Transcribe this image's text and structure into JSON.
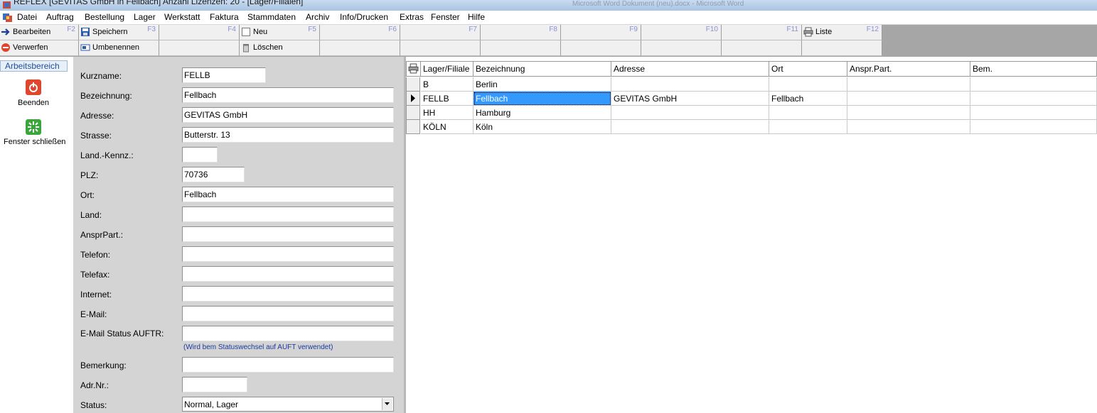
{
  "window": {
    "title": "REFLEX [GEVITAS GmbH in Fellbach] Anzahl Lizenzen: 20 - [Lager/Filialen]",
    "background_title": "Microsoft Word Dokument (neu).docx - Microsoft Word"
  },
  "menu": [
    "Datei",
    "Auftrag",
    "Bestellung",
    "Lager",
    "Werkstatt",
    "Faktura",
    "Stammdaten",
    "Archiv",
    "Info/Drucken",
    "Extras",
    "Fenster",
    "Hilfe"
  ],
  "toolbar": {
    "row1": [
      {
        "label": "Bearbeiten",
        "key": "F2",
        "icon": "arrow-right-icon"
      },
      {
        "label": "Speichern",
        "key": "F3",
        "icon": "save-icon"
      },
      {
        "label": "",
        "key": "F4"
      },
      {
        "label": "Neu",
        "key": "F5",
        "icon": "new-document-icon"
      },
      {
        "label": "",
        "key": "F6"
      },
      {
        "label": "",
        "key": "F7"
      },
      {
        "label": "",
        "key": "F8"
      },
      {
        "label": "",
        "key": "F9"
      },
      {
        "label": "",
        "key": "F10"
      },
      {
        "label": "",
        "key": "F11"
      },
      {
        "label": "Liste",
        "key": "F12",
        "icon": "printer-icon"
      }
    ],
    "row2": [
      {
        "label": "Verwerfen",
        "icon": "cancel-icon"
      },
      {
        "label": "Umbenennen",
        "icon": "rename-icon"
      },
      {
        "label": ""
      },
      {
        "label": "Löschen",
        "icon": "trash-icon"
      },
      {
        "label": ""
      },
      {
        "label": ""
      },
      {
        "label": ""
      },
      {
        "label": ""
      },
      {
        "label": ""
      },
      {
        "label": ""
      }
    ]
  },
  "sidebar": {
    "tab": "Arbeitsbereich",
    "exit_label": "Beenden",
    "close_label": "Fenster schließen"
  },
  "form": {
    "kurzname": {
      "label": "Kurzname:",
      "value": "FELLB"
    },
    "bezeichnung": {
      "label": "Bezeichnung:",
      "value": "Fellbach"
    },
    "adresse": {
      "label": "Adresse:",
      "value": "GEVITAS GmbH"
    },
    "strasse": {
      "label": "Strasse:",
      "value": "Butterstr. 13"
    },
    "land_kennz": {
      "label": "Land.-Kennz.:",
      "value": ""
    },
    "plz": {
      "label": "PLZ:",
      "value": "70736"
    },
    "ort": {
      "label": "Ort:",
      "value": "Fellbach"
    },
    "land": {
      "label": "Land:",
      "value": ""
    },
    "anspr": {
      "label": "AnsprPart.:",
      "value": ""
    },
    "telefon": {
      "label": "Telefon:",
      "value": ""
    },
    "telefax": {
      "label": "Telefax:",
      "value": ""
    },
    "internet": {
      "label": "Internet:",
      "value": ""
    },
    "email": {
      "label": "E-Mail:",
      "value": ""
    },
    "email_status": {
      "label": "E-Mail Status AUFTR:",
      "value": "",
      "hint": "(Wird bem Statuswechsel auf AUFT verwendet)"
    },
    "bemerkung": {
      "label": "Bemerkung:",
      "value": ""
    },
    "adrnr": {
      "label": "Adr.Nr.:",
      "value": ""
    },
    "status": {
      "label": "Status:",
      "value": "Normal, Lager"
    }
  },
  "grid": {
    "columns": [
      "Lager/Filiale",
      "Bezeichnung",
      "Adresse",
      "Ort",
      "Anspr.Part.",
      "Bem."
    ],
    "rows": [
      [
        "B",
        "Berlin",
        "",
        "",
        "",
        ""
      ],
      [
        "FELLB",
        "Fellbach",
        "GEVITAS GmbH",
        "Fellbach",
        "",
        ""
      ],
      [
        "HH",
        "Hamburg",
        "",
        "",
        "",
        ""
      ],
      [
        "KÖLN",
        "Köln",
        "",
        "",
        "",
        ""
      ]
    ],
    "selected_row": 1
  },
  "colors": {
    "toolbar_bg": "#a6a6a6",
    "form_bg": "#d4d4d4",
    "selection": "#3399ff",
    "hint": "#1c3a9e",
    "fkey": "#8a8fd6"
  }
}
